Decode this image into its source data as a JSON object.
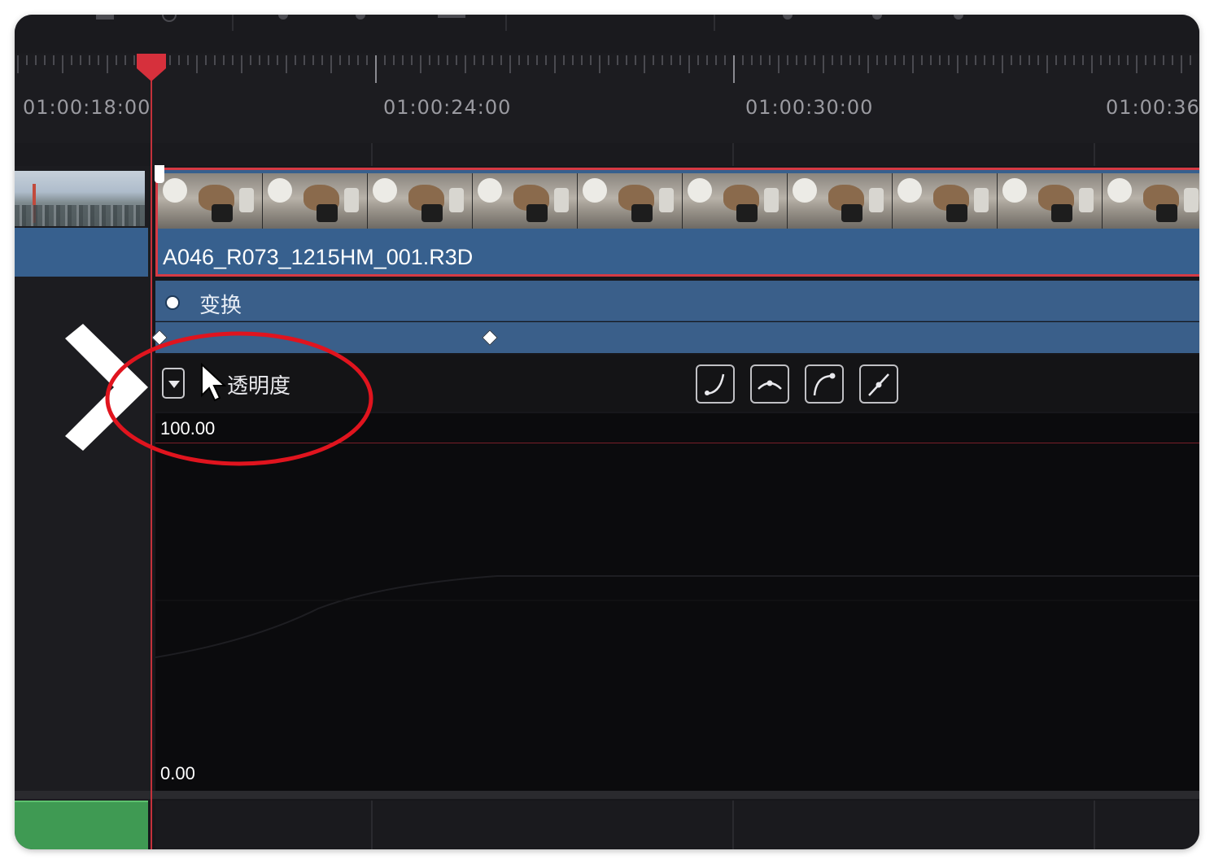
{
  "timeline": {
    "timecodes": [
      "01:00:18:00",
      "01:00:24:00",
      "01:00:30:00",
      "01:00:36:"
    ]
  },
  "clip": {
    "name": "A046_R073_1215HM_001.R3D"
  },
  "transform": {
    "label": "变换"
  },
  "opacity": {
    "label": "透明度",
    "max_value": "100.00",
    "min_value": "0.00"
  },
  "curve_buttons": [
    {
      "name": "ease-in-icon"
    },
    {
      "name": "ease-in-out-icon"
    },
    {
      "name": "ease-out-icon"
    },
    {
      "name": "linear-icon"
    }
  ],
  "subtitle": {
    "text": ""
  },
  "colors": {
    "playhead": "#c4313b",
    "video_track": "#37608e",
    "audio_track": "#3f9a53",
    "clip_selected_border": "#d63a44",
    "annotation": "#e0141e"
  }
}
